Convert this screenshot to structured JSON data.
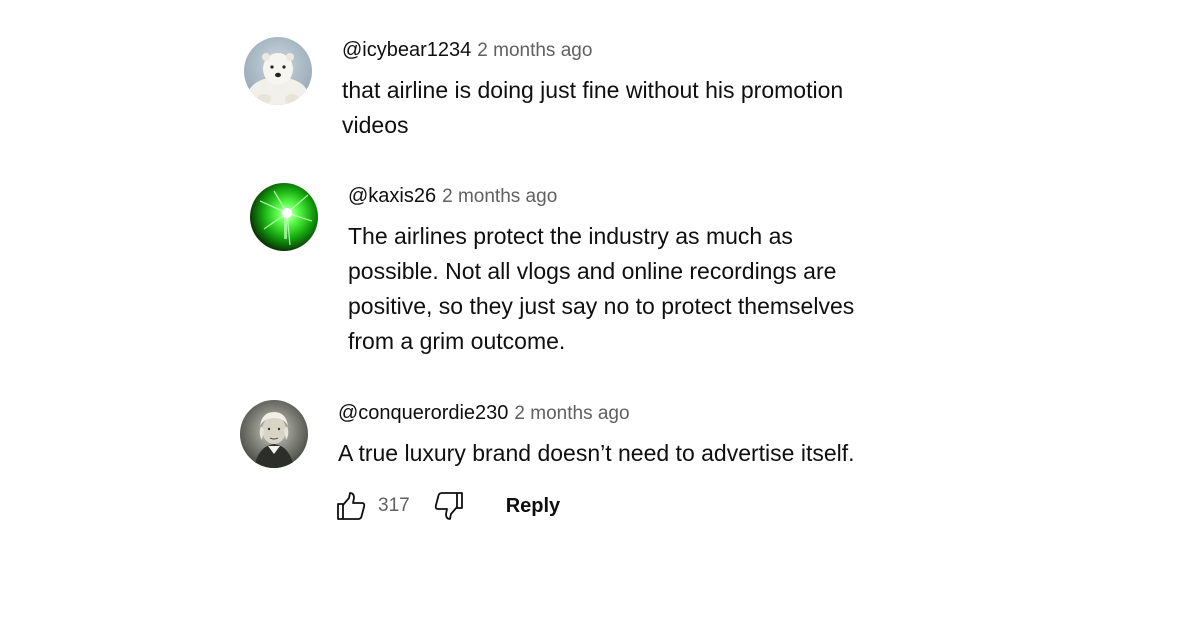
{
  "comments": [
    {
      "author": "@icybear1234",
      "time": "2 months ago",
      "lines": [
        "that airline is doing just fine without his promotion",
        "videos"
      ],
      "avatar_icon": "polar-bear-avatar"
    },
    {
      "author": "@kaxis26",
      "time": "2 months ago",
      "lines": [
        "The airlines protect the industry as much as",
        "possible. Not all vlogs and online recordings are",
        "positive, so they just say no to protect themselves",
        "from a grim outcome."
      ],
      "avatar_icon": "green-light-avatar"
    },
    {
      "author": "@conquerordie230",
      "time": "2 months ago",
      "lines": [
        "A true luxury brand doesn’t need to advertise itself."
      ],
      "avatar_icon": "portrait-avatar",
      "likes": "317",
      "reply_label": "Reply"
    }
  ],
  "icons": {
    "like": "thumbs-up-icon",
    "dislike": "thumbs-down-icon"
  },
  "colors": {
    "text_primary": "#0f0f0f",
    "text_secondary": "#606060"
  }
}
